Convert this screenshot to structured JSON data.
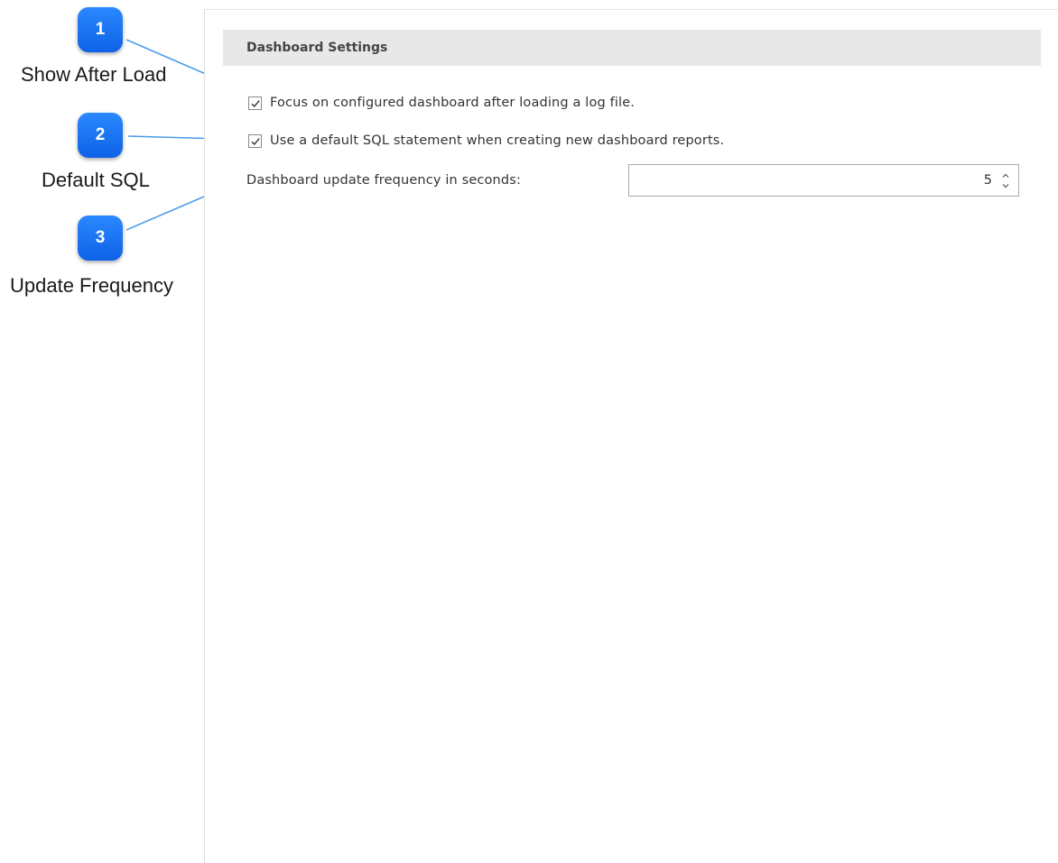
{
  "settings": {
    "section_title": "Dashboard Settings",
    "focus_option": {
      "label": "Focus on configured dashboard after loading a log file.",
      "checked": true
    },
    "default_sql_option": {
      "label": "Use a default SQL statement when creating new dashboard reports.",
      "checked": true
    },
    "update_frequency": {
      "label": "Dashboard update frequency in seconds:",
      "value": "5"
    }
  },
  "callouts": [
    {
      "number": "1",
      "label": "Show After Load"
    },
    {
      "number": "2",
      "label": "Default SQL"
    },
    {
      "number": "3",
      "label": "Update Frequency"
    }
  ],
  "colors": {
    "callout_blue": "#1677f5",
    "connector": "#4a9be8",
    "section_header_bg": "#e8e8e8"
  },
  "icons": {
    "checkbox_mark": "checkmark-icon",
    "spin_up": "chevron-up-icon",
    "spin_down": "chevron-down-icon"
  }
}
